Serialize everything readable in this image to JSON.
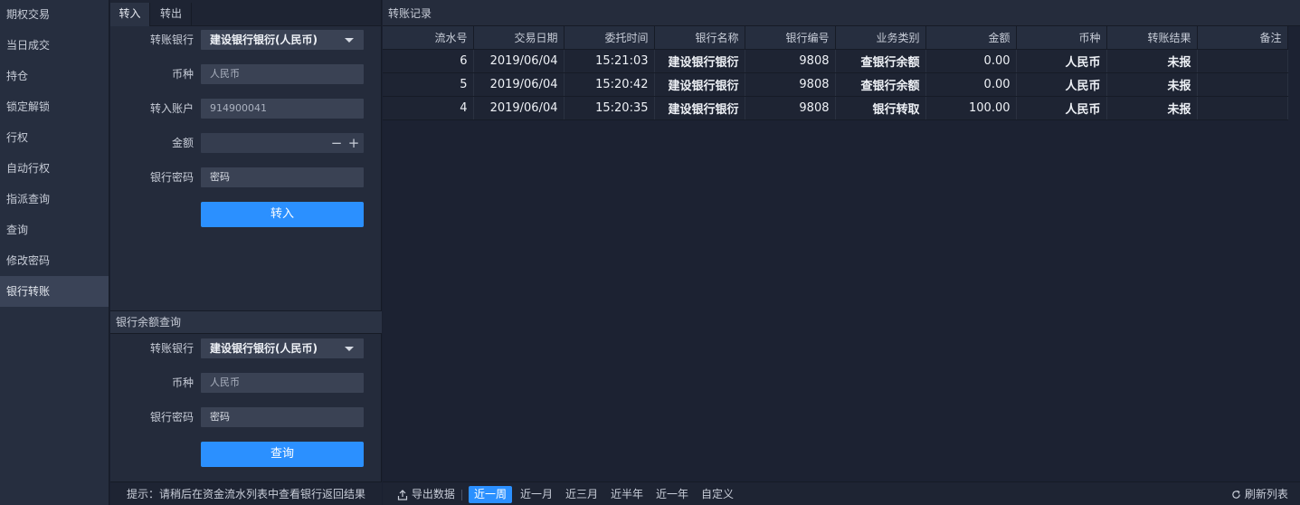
{
  "sidebar": {
    "items": [
      {
        "label": "期权交易"
      },
      {
        "label": "当日成交"
      },
      {
        "label": "持仓"
      },
      {
        "label": "锁定解锁"
      },
      {
        "label": "行权"
      },
      {
        "label": "自动行权"
      },
      {
        "label": "指派查询"
      },
      {
        "label": "查询"
      },
      {
        "label": "修改密码"
      },
      {
        "label": "银行转账",
        "active": true
      }
    ]
  },
  "transfer_tabs": {
    "in_label": "转入",
    "out_label": "转出",
    "active": "转入"
  },
  "transfer_form": {
    "bank_label": "转账银行",
    "bank_value": "建设银行银衍(人民币)",
    "currency_label": "币种",
    "currency_value": "人民币",
    "account_label": "转入账户",
    "account_value": "914900041",
    "amount_label": "金额",
    "amount_value": "",
    "minus_symbol": "−",
    "plus_symbol": "+",
    "password_label": "银行密码",
    "password_placeholder": "密码",
    "submit_label": "转入"
  },
  "balance_query": {
    "header": "银行余额查询",
    "bank_label": "转账银行",
    "bank_value": "建设银行银衍(人民币)",
    "currency_label": "币种",
    "currency_value": "人民币",
    "password_label": "银行密码",
    "password_placeholder": "密码",
    "submit_label": "查询"
  },
  "hint": "提示：请稍后在资金流水列表中查看银行返回结果",
  "records": {
    "header": "转账记录",
    "columns": [
      "流水号",
      "交易日期",
      "委托时间",
      "银行名称",
      "银行编号",
      "业务类别",
      "金额",
      "币种",
      "转账结果",
      "备注"
    ],
    "rows": [
      [
        "6",
        "2019/06/04",
        "15:21:03",
        "建设银行银衍",
        "9808",
        "查银行余额",
        "0.00",
        "人民币",
        "未报",
        ""
      ],
      [
        "5",
        "2019/06/04",
        "15:20:42",
        "建设银行银衍",
        "9808",
        "查银行余额",
        "0.00",
        "人民币",
        "未报",
        ""
      ],
      [
        "4",
        "2019/06/04",
        "15:20:35",
        "建设银行银衍",
        "9808",
        "银行转取",
        "100.00",
        "人民币",
        "未报",
        ""
      ]
    ]
  },
  "toolbar": {
    "export_label": "导出数据",
    "ranges": [
      "近一周",
      "近一月",
      "近三月",
      "近半年",
      "近一年",
      "自定义"
    ],
    "active_range": "近一周",
    "refresh_label": "刷新列表"
  },
  "colors": {
    "accent": "#2b90ff",
    "background": "#1a2030",
    "panel": "#242b3b"
  },
  "icons": {
    "export": "export-icon",
    "refresh": "refresh-icon",
    "dropdown": "chevron-down-icon"
  }
}
